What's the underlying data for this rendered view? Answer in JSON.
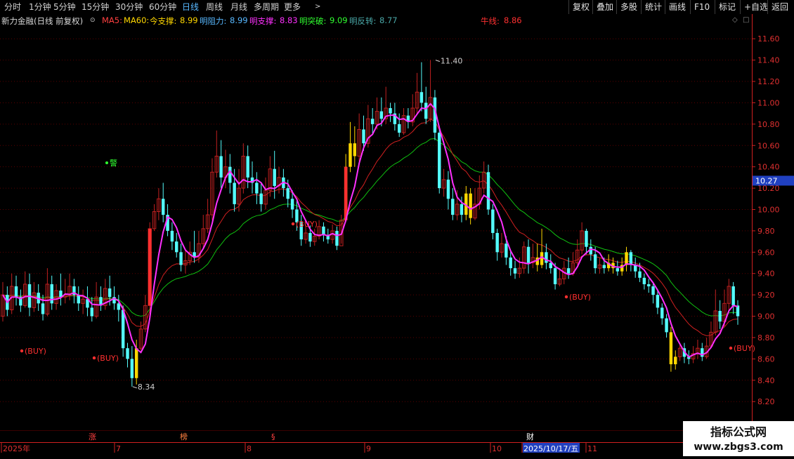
{
  "toolbar": {
    "left": [
      "分时",
      "1分钟",
      "5分钟",
      "15分钟",
      "30分钟",
      "60分钟",
      "日线",
      "周线",
      "月线",
      "多周期",
      "更多"
    ],
    "active": "日线",
    "right": [
      "复权",
      "叠加",
      "多股",
      "统计",
      "画线",
      "F10",
      "标记",
      "+自选",
      "返回"
    ]
  },
  "legend": {
    "stock": "新力金融(日线 前复权)",
    "ma5": "MA5:",
    "ma60": "MA60:",
    "support_label": "今支撑:",
    "support_value": "8.99",
    "resist_label": "明阻力:",
    "resist_value": "8.99",
    "msupport_label": "明支撑:",
    "msupport_value": "8.83",
    "breakout_label": "明突破:",
    "breakout_value": "9.09",
    "reversal_label": "明反转:",
    "reversal_value": "8.77",
    "bull_label": "牛线:",
    "bull_value": "8.86"
  },
  "colors": {
    "up": "#ff3030",
    "down": "#54fcfc",
    "yellow": "#ffd700",
    "ma_magenta": "#ff30ff",
    "ma_red": "#d02020",
    "ma_green": "#10c010",
    "axis": "#d02020",
    "grid": "#5a0000",
    "buy": "#ff3030"
  },
  "chart_data": {
    "type": "candlestick",
    "y_ticks": [
      "11.60",
      "11.40",
      "11.20",
      "11.00",
      "10.80",
      "10.60",
      "10.40",
      "10.20",
      "10.00",
      "9.80",
      "9.60",
      "9.40",
      "9.20",
      "9.00",
      "8.80",
      "8.60",
      "8.40",
      "8.20"
    ],
    "ylim": [
      8.05,
      11.7
    ],
    "current_price": "10.27",
    "x_labels": [
      "2025年",
      "7",
      "8",
      "9",
      "10",
      "2025/10/17/五",
      "11"
    ],
    "high_label": "11.40",
    "low_label": "8.34",
    "buy_label": "(BUY)",
    "warn_label": "警",
    "event_markers": [
      "涨",
      "榜",
      "§",
      "财"
    ],
    "candles": [
      [
        9.0,
        9.2,
        9.32,
        8.95
      ],
      [
        9.2,
        9.06,
        9.28,
        9.0
      ],
      [
        9.06,
        9.28,
        9.4,
        9.02
      ],
      [
        9.28,
        9.18,
        9.38,
        9.1
      ],
      [
        9.18,
        9.1,
        9.25,
        9.04
      ],
      [
        9.1,
        9.3,
        9.42,
        9.08
      ],
      [
        9.3,
        9.08,
        9.4,
        9.0
      ],
      [
        9.08,
        9.22,
        9.32,
        9.04
      ],
      [
        9.22,
        9.12,
        9.3,
        9.05
      ],
      [
        9.12,
        9.02,
        9.2,
        8.96
      ],
      [
        9.02,
        9.3,
        9.45,
        9.0
      ],
      [
        9.3,
        9.12,
        9.38,
        9.06
      ],
      [
        9.12,
        9.24,
        9.3,
        9.06
      ],
      [
        9.24,
        9.18,
        9.4,
        9.1
      ],
      [
        9.18,
        9.2,
        9.35,
        9.12
      ],
      [
        9.2,
        9.28,
        9.4,
        9.15
      ],
      [
        9.28,
        9.2,
        9.35,
        9.12
      ],
      [
        9.2,
        9.12,
        9.28,
        9.05
      ],
      [
        9.12,
        9.16,
        9.25,
        9.02
      ],
      [
        9.16,
        9.08,
        9.28,
        9.0
      ],
      [
        9.08,
        9.0,
        9.18,
        8.95
      ],
      [
        9.0,
        9.18,
        9.32,
        8.98
      ],
      [
        9.18,
        9.1,
        9.28,
        9.05
      ],
      [
        9.1,
        9.26,
        9.35,
        9.06
      ],
      [
        9.26,
        9.18,
        9.38,
        9.1
      ],
      [
        9.18,
        9.12,
        9.28,
        9.06
      ],
      [
        9.12,
        9.06,
        9.2,
        8.95
      ],
      [
        9.06,
        8.7,
        9.1,
        8.62
      ],
      [
        8.7,
        8.6,
        8.75,
        8.52
      ],
      [
        8.6,
        8.42,
        8.72,
        8.34
      ],
      [
        8.42,
        8.7,
        8.78,
        8.36
      ],
      [
        8.7,
        8.88,
        8.95,
        8.68
      ],
      [
        8.88,
        9.1,
        9.2,
        8.85
      ],
      [
        9.1,
        9.82,
        9.88,
        9.05
      ],
      [
        9.82,
        9.98,
        10.05,
        9.8
      ],
      [
        9.98,
        10.1,
        10.2,
        9.9
      ],
      [
        10.1,
        9.95,
        10.25,
        9.88
      ],
      [
        9.95,
        9.8,
        10.05,
        9.75
      ],
      [
        9.8,
        9.7,
        9.88,
        9.62
      ],
      [
        9.7,
        9.6,
        9.78,
        9.55
      ],
      [
        9.6,
        9.48,
        9.68,
        9.42
      ],
      [
        9.48,
        9.52,
        9.62,
        9.4
      ],
      [
        9.52,
        9.6,
        9.7,
        9.48
      ],
      [
        9.6,
        9.55,
        9.8,
        9.5
      ],
      [
        9.55,
        9.68,
        9.8,
        9.5
      ],
      [
        9.68,
        9.82,
        9.95,
        9.64
      ],
      [
        9.82,
        9.95,
        10.1,
        9.78
      ],
      [
        9.95,
        10.35,
        10.48,
        9.9
      ],
      [
        10.35,
        10.5,
        10.74,
        10.3
      ],
      [
        10.5,
        10.3,
        10.65,
        10.2
      ],
      [
        10.3,
        10.4,
        10.56,
        10.2
      ],
      [
        10.4,
        10.25,
        10.52,
        10.15
      ],
      [
        10.25,
        10.05,
        10.38,
        9.98
      ],
      [
        10.05,
        10.2,
        10.38,
        9.98
      ],
      [
        10.2,
        10.5,
        10.62,
        10.15
      ],
      [
        10.5,
        10.3,
        10.6,
        10.2
      ],
      [
        10.3,
        10.25,
        10.45,
        10.15
      ],
      [
        10.25,
        10.15,
        10.35,
        10.05
      ],
      [
        10.15,
        10.05,
        10.25,
        9.98
      ],
      [
        10.05,
        10.18,
        10.3,
        10.0
      ],
      [
        10.18,
        10.38,
        10.5,
        10.12
      ],
      [
        10.38,
        10.22,
        10.55,
        10.1
      ],
      [
        10.22,
        10.3,
        10.4,
        10.15
      ],
      [
        10.3,
        10.2,
        10.38,
        10.12
      ],
      [
        10.2,
        10.1,
        10.28,
        10.02
      ],
      [
        10.1,
        10.0,
        10.18,
        9.92
      ],
      [
        10.0,
        9.88,
        10.08,
        9.8
      ],
      [
        9.88,
        9.72,
        9.95,
        9.66
      ],
      [
        9.72,
        9.78,
        9.85,
        9.68
      ],
      [
        9.78,
        9.7,
        9.85,
        9.65
      ],
      [
        9.7,
        9.75,
        9.82,
        9.66
      ],
      [
        9.75,
        9.84,
        9.9,
        9.72
      ],
      [
        9.84,
        9.76,
        9.88,
        9.7
      ],
      [
        9.76,
        9.72,
        9.82,
        9.68
      ],
      [
        9.72,
        9.8,
        9.86,
        9.68
      ],
      [
        9.8,
        9.66,
        9.84,
        9.62
      ],
      [
        9.66,
        9.9,
        9.95,
        9.68
      ],
      [
        9.9,
        10.4,
        10.52,
        9.88
      ],
      [
        10.4,
        10.62,
        10.82,
        10.35
      ],
      [
        10.62,
        10.5,
        10.78,
        10.4
      ],
      [
        10.5,
        10.75,
        10.9,
        10.45
      ],
      [
        10.75,
        10.62,
        10.88,
        10.55
      ],
      [
        10.62,
        10.85,
        10.98,
        10.58
      ],
      [
        10.85,
        10.8,
        10.95,
        10.7
      ],
      [
        10.8,
        10.92,
        11.05,
        10.75
      ],
      [
        10.92,
        10.85,
        11.05,
        10.78
      ],
      [
        10.85,
        10.95,
        11.15,
        10.8
      ],
      [
        10.95,
        10.9,
        11.0,
        10.82
      ],
      [
        10.9,
        10.8,
        11.0,
        10.74
      ],
      [
        10.8,
        10.72,
        10.9,
        10.68
      ],
      [
        10.72,
        10.88,
        10.95,
        10.7
      ],
      [
        10.88,
        10.82,
        10.95,
        10.76
      ],
      [
        10.82,
        10.95,
        11.08,
        10.78
      ],
      [
        10.95,
        11.1,
        11.28,
        10.9
      ],
      [
        11.1,
        11.0,
        11.38,
        10.92
      ],
      [
        11.0,
        10.85,
        11.15,
        10.8
      ],
      [
        10.85,
        11.05,
        11.4,
        10.82
      ],
      [
        11.05,
        10.72,
        11.12,
        10.65
      ],
      [
        10.72,
        10.2,
        10.78,
        10.15
      ],
      [
        10.2,
        10.28,
        10.38,
        10.12
      ],
      [
        10.28,
        10.1,
        10.36,
        10.0
      ],
      [
        10.1,
        9.95,
        10.2,
        9.9
      ],
      [
        9.95,
        10.05,
        10.18,
        9.9
      ],
      [
        10.05,
        9.95,
        10.12,
        9.88
      ],
      [
        9.95,
        10.15,
        10.22,
        9.9
      ],
      [
        10.15,
        9.92,
        10.2,
        9.86
      ],
      [
        9.92,
        10.05,
        10.2,
        9.9
      ],
      [
        10.05,
        10.2,
        10.32,
        10.0
      ],
      [
        10.2,
        10.35,
        10.45,
        10.15
      ],
      [
        10.35,
        10.0,
        10.42,
        9.95
      ],
      [
        10.0,
        9.78,
        10.05,
        9.72
      ],
      [
        9.78,
        9.6,
        9.82,
        9.52
      ],
      [
        9.6,
        9.68,
        9.78,
        9.55
      ],
      [
        9.68,
        9.55,
        9.75,
        9.48
      ],
      [
        9.55,
        9.45,
        9.62,
        9.38
      ],
      [
        9.45,
        9.4,
        9.52,
        9.35
      ],
      [
        9.4,
        9.45,
        9.55,
        9.36
      ],
      [
        9.45,
        9.65,
        9.7,
        9.4
      ],
      [
        9.65,
        9.5,
        9.72,
        9.4
      ],
      [
        9.5,
        9.55,
        9.68,
        9.45
      ],
      [
        9.55,
        9.48,
        9.68,
        9.42
      ],
      [
        9.48,
        9.6,
        9.82,
        9.45
      ],
      [
        9.6,
        9.5,
        9.68,
        9.44
      ],
      [
        9.5,
        9.45,
        9.58,
        9.4
      ],
      [
        9.45,
        9.3,
        9.5,
        9.25
      ],
      [
        9.3,
        9.35,
        9.45,
        9.28
      ],
      [
        9.35,
        9.45,
        9.52,
        9.3
      ],
      [
        9.45,
        9.4,
        9.55,
        9.35
      ],
      [
        9.4,
        9.5,
        9.6,
        9.38
      ],
      [
        9.5,
        9.62,
        9.72,
        9.48
      ],
      [
        9.62,
        9.8,
        9.88,
        9.58
      ],
      [
        9.8,
        9.65,
        9.82,
        9.58
      ],
      [
        9.65,
        9.58,
        9.72,
        9.52
      ],
      [
        9.58,
        9.45,
        9.65,
        9.4
      ],
      [
        9.45,
        9.48,
        9.55,
        9.4
      ],
      [
        9.48,
        9.45,
        9.55,
        9.4
      ],
      [
        9.45,
        9.5,
        9.58,
        9.42
      ],
      [
        9.5,
        9.45,
        9.55,
        9.4
      ],
      [
        9.45,
        9.42,
        9.52,
        9.38
      ],
      [
        9.42,
        9.48,
        9.55,
        9.38
      ],
      [
        9.48,
        9.6,
        9.65,
        9.42
      ],
      [
        9.6,
        9.48,
        9.62,
        9.42
      ],
      [
        9.48,
        9.42,
        9.55,
        9.36
      ],
      [
        9.42,
        9.36,
        9.5,
        9.32
      ],
      [
        9.36,
        9.3,
        9.4,
        9.25
      ],
      [
        9.3,
        9.28,
        9.35,
        9.22
      ],
      [
        9.28,
        9.2,
        9.32,
        9.12
      ],
      [
        9.2,
        9.08,
        9.25,
        9.02
      ],
      [
        9.08,
        8.98,
        9.12,
        8.92
      ],
      [
        8.98,
        8.85,
        9.02,
        8.8
      ],
      [
        8.85,
        8.55,
        8.9,
        8.48
      ],
      [
        8.55,
        8.62,
        8.68,
        8.5
      ],
      [
        8.62,
        8.7,
        8.75,
        8.58
      ],
      [
        8.7,
        8.62,
        8.75,
        8.56
      ],
      [
        8.62,
        8.6,
        8.68,
        8.55
      ],
      [
        8.6,
        8.65,
        8.72,
        8.56
      ],
      [
        8.65,
        8.7,
        8.78,
        8.6
      ],
      [
        8.7,
        8.62,
        8.75,
        8.58
      ],
      [
        8.62,
        8.72,
        8.8,
        8.6
      ],
      [
        8.72,
        8.85,
        8.95,
        8.7
      ],
      [
        8.85,
        9.05,
        9.25,
        8.82
      ],
      [
        9.05,
        8.95,
        9.15,
        8.88
      ],
      [
        8.95,
        9.12,
        9.25,
        8.9
      ],
      [
        9.12,
        9.28,
        9.35,
        9.05
      ],
      [
        9.28,
        9.1,
        9.32,
        9.02
      ],
      [
        9.1,
        9.0,
        9.15,
        8.92
      ]
    ],
    "yellow_indices": [
      30,
      77,
      78,
      79,
      104,
      105,
      120,
      121,
      136,
      137,
      139,
      140,
      150,
      151
    ]
  }
}
